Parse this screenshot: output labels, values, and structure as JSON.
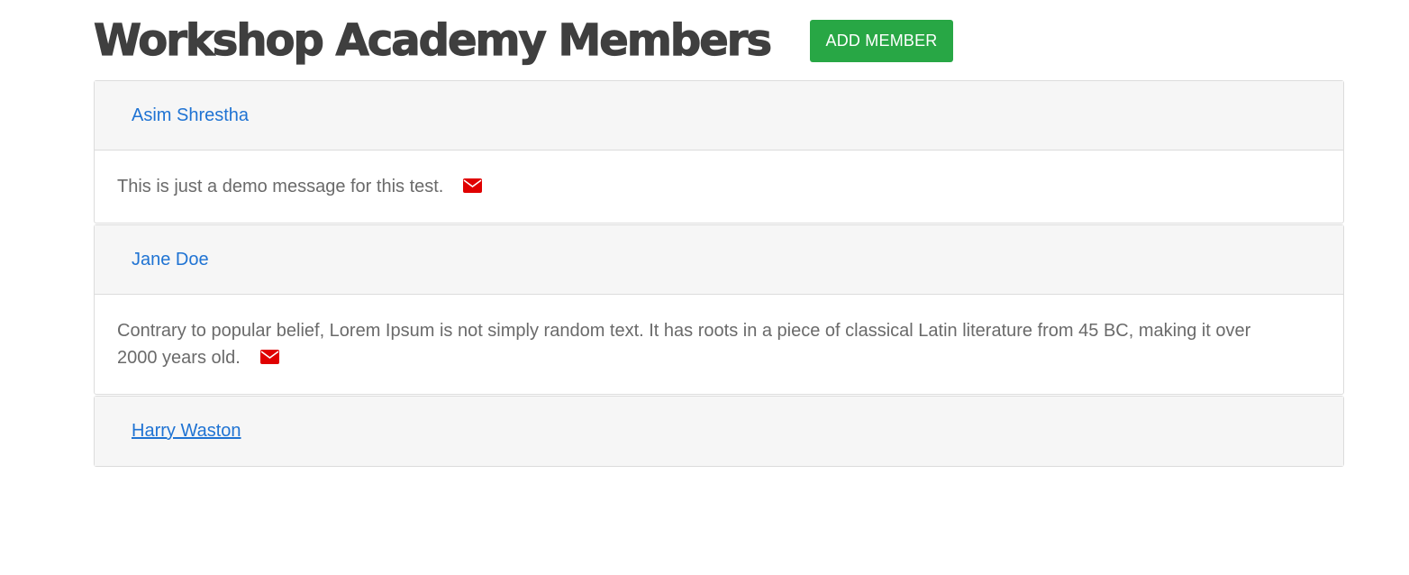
{
  "page": {
    "title": "Workshop Academy Members",
    "add_button_label": "ADD MEMBER"
  },
  "colors": {
    "title": "#3f3f3f",
    "add_button": "#28a745",
    "link": "#1f73d3",
    "mail_icon": "#e00000",
    "body_text": "#6a6a6a",
    "card_header_bg": "#f6f6f6"
  },
  "members": [
    {
      "name": "Asim Shrestha",
      "message": "This is just a demo message for this test.",
      "icon": "envelope-icon",
      "expanded": true
    },
    {
      "name": "Jane Doe",
      "message": "Contrary to popular belief, Lorem Ipsum is not simply random text. It has roots in a piece of classical Latin literature from 45 BC, making it over 2000 years old.",
      "icon": "envelope-icon",
      "expanded": true
    },
    {
      "name": "Harry Waston",
      "expanded": false
    }
  ]
}
